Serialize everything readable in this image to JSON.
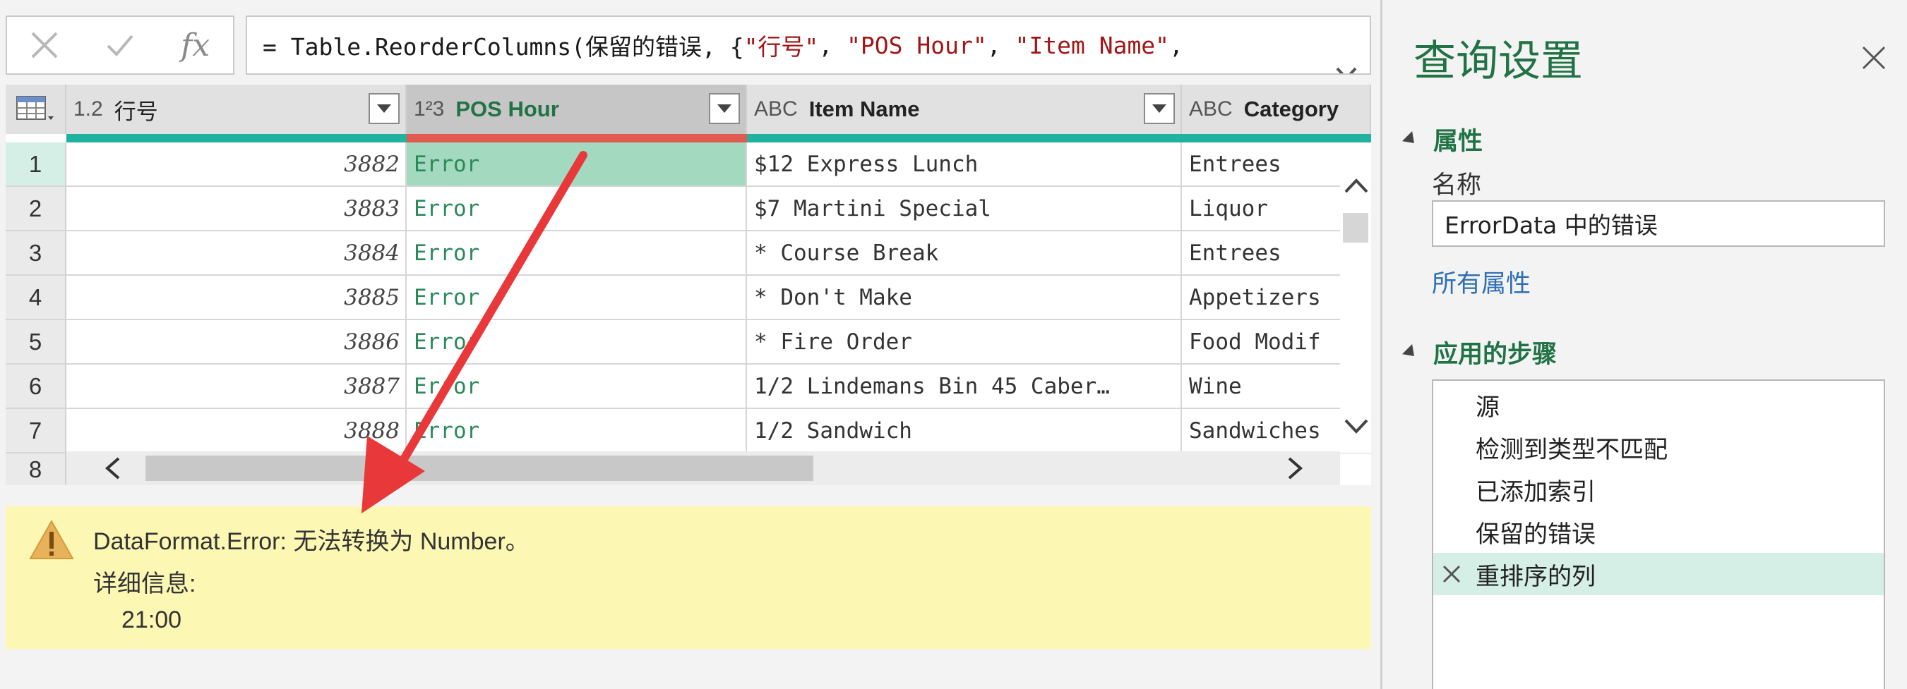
{
  "formula_bar": {
    "cancel_icon": "x-icon",
    "commit_icon": "check-icon",
    "fx_label": "fx",
    "formula_prefix": "= Table.ReorderColumns(保留的错误, {",
    "formula_str1": "\"行号\"",
    "sep1": ", ",
    "formula_str2": "\"POS Hour\"",
    "sep2": ", ",
    "formula_str3": "\"Item Name\"",
    "formula_suffix": ","
  },
  "grid": {
    "columns": [
      {
        "type": "1.2",
        "name": "行号"
      },
      {
        "type": "1²3",
        "name": "POS Hour"
      },
      {
        "type": "ABC",
        "name": "Item Name"
      },
      {
        "type": "ABC",
        "name": "Category"
      }
    ],
    "rows": [
      {
        "n": "1",
        "row": "3882",
        "pos": "Error",
        "item": "$12 Express Lunch",
        "cat": "Entrees"
      },
      {
        "n": "2",
        "row": "3883",
        "pos": "Error",
        "item": "$7 Martini Special",
        "cat": "Liquor"
      },
      {
        "n": "3",
        "row": "3884",
        "pos": "Error",
        "item": "* Course Break",
        "cat": "Entrees"
      },
      {
        "n": "4",
        "row": "3885",
        "pos": "Error",
        "item": "* Don't Make",
        "cat": "Appetizers"
      },
      {
        "n": "5",
        "row": "3886",
        "pos": "Error",
        "item": "* Fire Order",
        "cat": "Food Modif"
      },
      {
        "n": "6",
        "row": "3887",
        "pos": "Error",
        "item": "1/2 Lindemans Bin 45 Caber…",
        "cat": "Wine"
      },
      {
        "n": "7",
        "row": "3888",
        "pos": "Error",
        "item": "1/2 Sandwich",
        "cat": "Sandwiches"
      },
      {
        "n": "8"
      }
    ]
  },
  "error_pane": {
    "message": "DataFormat.Error: 无法转换为 Number。",
    "details_label": "详细信息:",
    "value": "21:00"
  },
  "query_settings": {
    "title": "查询设置",
    "properties_heading": "属性",
    "name_label": "名称",
    "name_value": "ErrorData 中的错误",
    "all_properties_link": "所有属性",
    "steps_heading": "应用的步骤",
    "steps": [
      "源",
      "检测到类型不匹配",
      "已添加索引",
      "保留的错误",
      "重排序的列"
    ]
  },
  "colors": {
    "accent": "#217346",
    "quality_ok": "#1fb29e",
    "quality_error": "#e05a52",
    "selected_cell": "#a3d9bf",
    "warning_bg": "#fdf7b4",
    "annotation_arrow": "#e8383a"
  }
}
